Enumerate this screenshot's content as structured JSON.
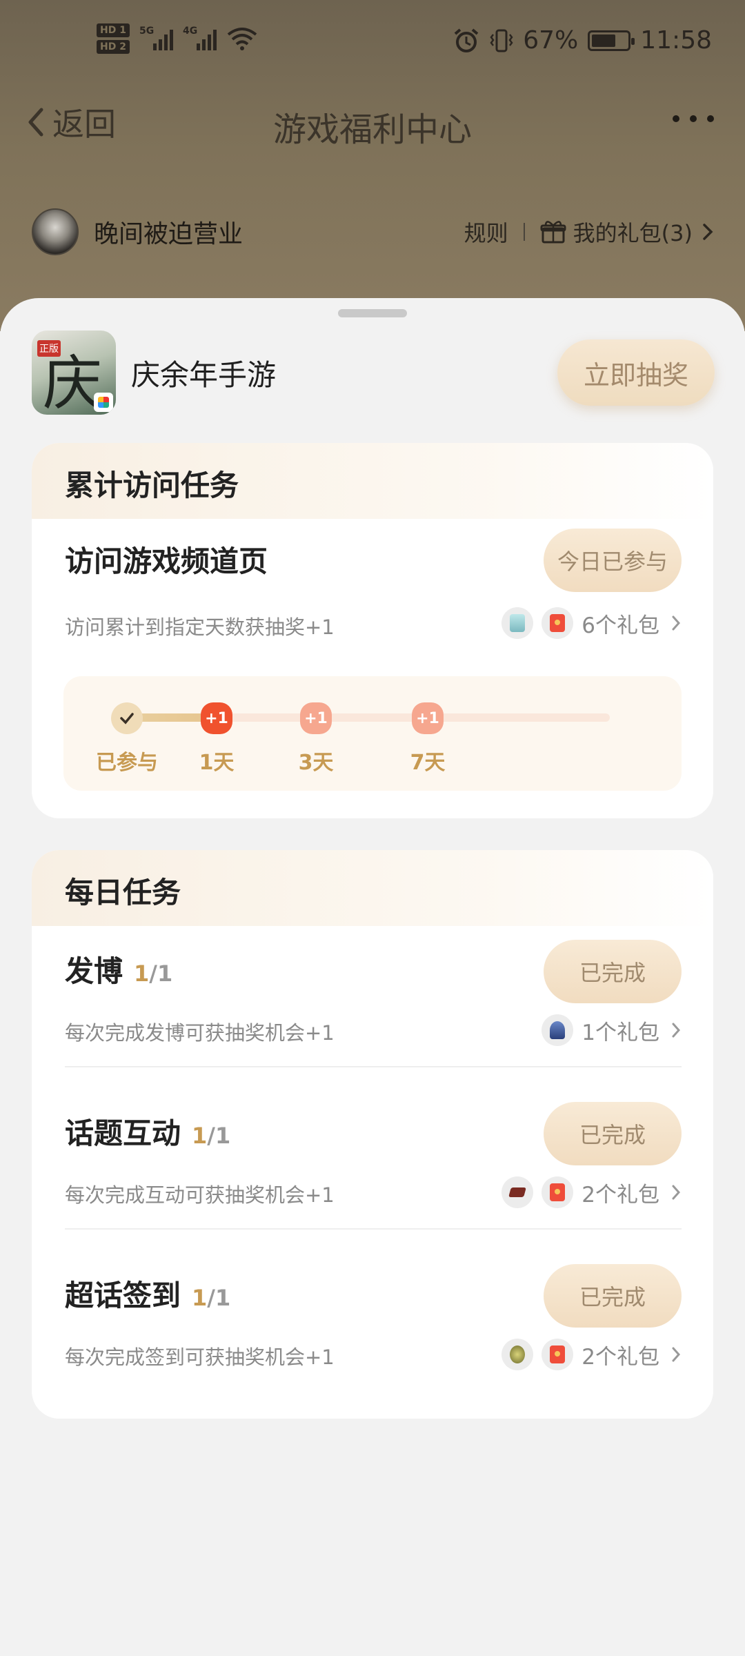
{
  "status_bar": {
    "network_5g": "5G",
    "network_4g": "4G",
    "hd1": "HD 1",
    "hd2": "HD 2",
    "battery_percent": "67%",
    "battery_level": 0.67,
    "time": "11:58"
  },
  "nav": {
    "back_label": "返回",
    "title": "游戏福利中心"
  },
  "user": {
    "name": "晚间被迫营业",
    "rules_label": "规则",
    "my_gifts_label": "我的礼包(3)"
  },
  "game": {
    "name": "庆余年手游",
    "icon_char": "庆",
    "icon_tag": "正版",
    "draw_button": "立即抽奖"
  },
  "cumulative_section": {
    "title": "累计访问任务",
    "task": {
      "title": "访问游戏频道页",
      "description": "访问累计到指定天数获抽奖+1",
      "status": "今日已参与",
      "gifts_label": "6个礼包"
    },
    "progress": {
      "nodes": [
        {
          "label": "已参与",
          "badge": ""
        },
        {
          "label": "1天",
          "badge": "+1"
        },
        {
          "label": "3天",
          "badge": "+1"
        },
        {
          "label": "7天",
          "badge": "+1"
        }
      ]
    }
  },
  "daily_section": {
    "title": "每日任务",
    "tasks": [
      {
        "title": "发博",
        "done": "1",
        "total": "/1",
        "description": "每次完成发博可获抽奖机会+1",
        "status": "已完成",
        "gifts_label": "1个礼包"
      },
      {
        "title": "话题互动",
        "done": "1",
        "total": "/1",
        "description": "每次完成互动可获抽奖机会+1",
        "status": "已完成",
        "gifts_label": "2个礼包"
      },
      {
        "title": "超话签到",
        "done": "1",
        "total": "/1",
        "description": "每次完成签到可获抽奖机会+1",
        "status": "已完成",
        "gifts_label": "2个礼包"
      }
    ]
  },
  "colors": {
    "accent_gold": "#c79a52",
    "button_bg": "#f1dcc0",
    "badge_red": "#f0522e",
    "badge_salmon": "#f6a78f"
  }
}
